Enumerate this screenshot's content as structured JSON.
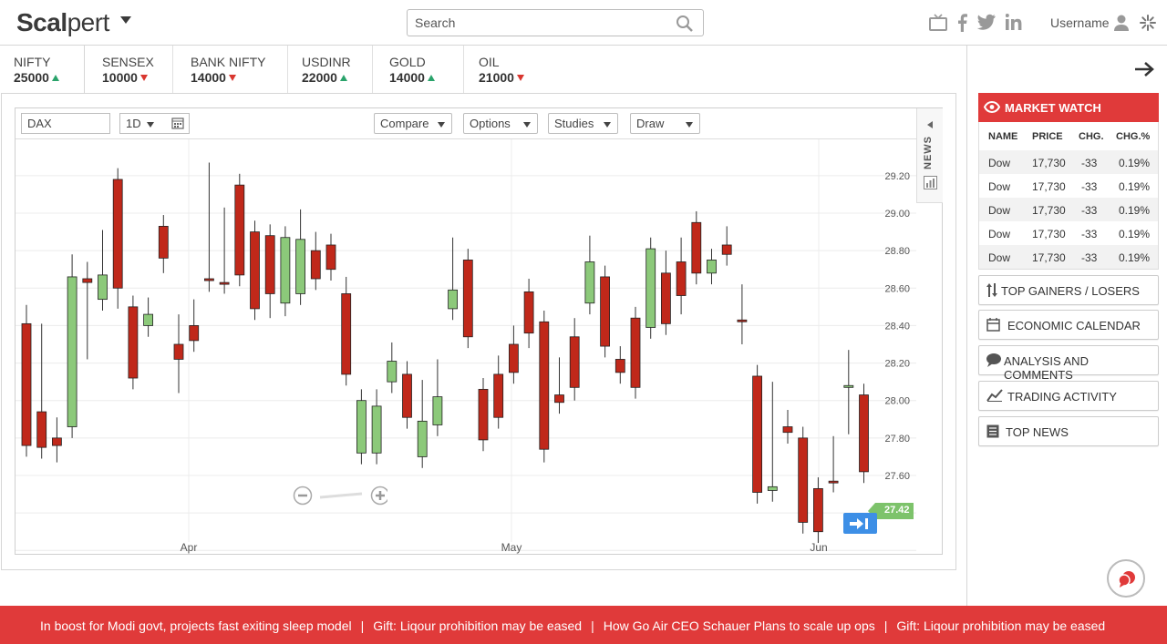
{
  "header": {
    "logo_bold": "Scal",
    "logo_rest": "pert",
    "search_placeholder": "Search",
    "username": "Username",
    "social_icons": [
      "tv-icon",
      "facebook-icon",
      "twitter-icon",
      "linkedin-icon"
    ]
  },
  "tabs": [
    {
      "name": "NIFTY",
      "value": "25000",
      "dir": "up"
    },
    {
      "name": "SENSEX",
      "value": "10000",
      "dir": "down"
    },
    {
      "name": "BANK NIFTY",
      "value": "14000",
      "dir": "down"
    },
    {
      "name": "USDINR",
      "value": "22000",
      "dir": "up"
    },
    {
      "name": "GOLD",
      "value": "14000",
      "dir": "up"
    },
    {
      "name": "OIL",
      "value": "21000",
      "dir": "down"
    }
  ],
  "toolbar": {
    "symbol": "DAX",
    "interval": "1D",
    "compare": "Compare",
    "options": "Options",
    "studies": "Studies",
    "draw": "Draw",
    "news": "NEWS"
  },
  "chart_data": {
    "type": "candlestick",
    "x_labels": [
      "Apr",
      "May",
      "Jun"
    ],
    "y_ticks": [
      "29.20",
      "29.00",
      "28.80",
      "28.60",
      "28.40",
      "28.20",
      "28.00",
      "27.80",
      "27.60"
    ],
    "ylim": [
      27.2,
      29.4
    ],
    "last_price": "27.42",
    "up_color": "#8cc97a",
    "down_color": "#c0281a",
    "candles": [
      [
        28.41,
        28.45,
        27.82,
        27.76
      ],
      [
        27.94,
        27.95,
        28.35,
        27.75
      ],
      [
        27.8,
        27.73,
        27.85,
        27.76
      ],
      [
        27.86,
        27.86,
        28.72,
        28.66
      ],
      [
        28.65,
        28.28,
        28.68,
        28.63
      ],
      [
        28.54,
        28.85,
        28.54,
        28.67
      ],
      [
        29.18,
        29.18,
        28.55,
        28.6
      ],
      [
        28.5,
        28.42,
        28.5,
        28.12
      ],
      [
        28.4,
        28.41,
        28.49,
        28.46
      ],
      [
        28.93,
        28.93,
        28.74,
        28.76
      ],
      [
        28.3,
        28.4,
        28.1,
        28.22
      ],
      [
        28.4,
        28.48,
        28.42,
        28.32
      ],
      [
        28.65,
        29.21,
        28.65,
        28.64
      ],
      [
        28.63,
        28.97,
        28.9,
        28.63
      ],
      [
        29.15,
        29.15,
        28.67,
        28.67
      ],
      [
        28.9,
        28.9,
        28.55,
        28.49
      ],
      [
        28.88,
        28.88,
        28.5,
        28.57
      ],
      [
        28.52,
        28.86,
        28.51,
        28.87
      ],
      [
        28.57,
        28.96,
        28.57,
        28.86
      ],
      [
        28.8,
        28.84,
        28.75,
        28.65
      ],
      [
        28.83,
        28.83,
        28.7,
        28.7
      ],
      [
        28.57,
        28.6,
        28.3,
        28.14
      ],
      [
        27.72,
        27.98,
        27.72,
        28.0
      ],
      [
        27.72,
        28.0,
        27.72,
        27.97
      ],
      [
        28.1,
        28.25,
        28.1,
        28.21
      ],
      [
        28.14,
        28.15,
        28.08,
        27.91
      ],
      [
        27.7,
        28.05,
        27.7,
        27.89
      ],
      [
        27.87,
        28.16,
        27.87,
        28.02
      ],
      [
        28.49,
        28.81,
        28.49,
        28.59
      ],
      [
        28.75,
        28.75,
        28.35,
        28.34
      ],
      [
        28.06,
        28.04,
        27.9,
        27.79
      ],
      [
        28.14,
        28.18,
        27.91,
        27.91
      ],
      [
        28.3,
        28.34,
        28.25,
        28.15
      ],
      [
        28.58,
        28.59,
        28.34,
        28.36
      ],
      [
        28.42,
        28.42,
        27.73,
        27.74
      ],
      [
        28.03,
        28.17,
        28.03,
        27.99
      ],
      [
        28.34,
        28.38,
        28.06,
        28.07
      ],
      [
        28.52,
        28.82,
        28.52,
        28.74
      ],
      [
        28.66,
        28.66,
        28.33,
        28.29
      ],
      [
        28.22,
        28.23,
        28.19,
        28.15
      ],
      [
        28.44,
        28.44,
        28.1,
        28.07
      ],
      [
        28.39,
        28.8,
        28.39,
        28.81
      ],
      [
        28.68,
        28.74,
        28.68,
        28.41
      ],
      [
        28.74,
        28.81,
        28.52,
        28.56
      ],
      [
        28.95,
        28.95,
        28.82,
        28.68
      ],
      [
        28.68,
        28.75,
        28.68,
        28.75
      ],
      [
        28.83,
        28.87,
        28.81,
        28.78
      ],
      [
        28.43,
        28.56,
        28.36,
        28.43
      ],
      [
        28.13,
        28.13,
        27.51,
        27.51
      ],
      [
        27.52,
        28.04,
        27.52,
        27.54
      ],
      [
        27.86,
        27.89,
        27.83,
        27.83
      ],
      [
        27.8,
        27.8,
        27.39,
        27.35
      ],
      [
        27.53,
        27.53,
        27.35,
        27.3
      ],
      [
        27.57,
        27.75,
        27.57,
        27.57
      ],
      [
        28.07,
        28.21,
        27.88,
        28.08
      ],
      [
        28.03,
        28.03,
        27.7,
        27.62
      ]
    ]
  },
  "market_watch": {
    "title": "MARKET WATCH",
    "headers": [
      "NAME",
      "PRICE",
      "CHG.",
      "CHG.%"
    ],
    "rows": [
      [
        "Dow",
        "17,730",
        "-33",
        "0.19%"
      ],
      [
        "Dow",
        "17,730",
        "-33",
        "0.19%"
      ],
      [
        "Dow",
        "17,730",
        "-33",
        "0.19%"
      ],
      [
        "Dow",
        "17,730",
        "-33",
        "0.19%"
      ],
      [
        "Dow",
        "17,730",
        "-33",
        "0.19%"
      ]
    ]
  },
  "panel_buttons": [
    {
      "label": "TOP GAINERS / LOSERS",
      "icon": "gainers-losers-icon"
    },
    {
      "label": "ECONOMIC CALENDAR",
      "icon": "calendar-icon"
    },
    {
      "label": "ANALYSIS AND COMMENTS",
      "icon": "comment-icon"
    },
    {
      "label": "TRADING ACTIVITY",
      "icon": "activity-icon"
    },
    {
      "label": "TOP NEWS",
      "icon": "news-icon"
    }
  ],
  "ticker": [
    "In boost for Modi govt, projects fast exiting sleep model",
    "Gift: Liqour prohibition may be eased",
    "How Go Air CEO Schauer Plans to scale up ops",
    "Gift: Liqour prohibition may be eased"
  ],
  "colors": {
    "accent": "#e03a3a",
    "up": "#2aa36b",
    "down": "#d9362f",
    "jump": "#3d8fe6"
  }
}
